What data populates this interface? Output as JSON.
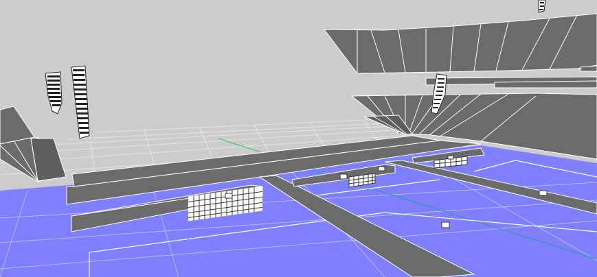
{
  "viewport": {
    "mode": "wireframe-3d-scene",
    "colors": {
      "background": "#cccccc",
      "floor": "#8080ff",
      "geometry": "#6b6b6b",
      "edge": "#ffffff",
      "grid_line": "#e8e8e8",
      "axis_green": "#2ecc40",
      "axis_teal": "#1aa58a"
    },
    "objects": [
      {
        "name": "left-speaker-array",
        "type": "line-array-speaker"
      },
      {
        "name": "center-speaker-array",
        "type": "line-array-speaker"
      },
      {
        "name": "right-speaker-array",
        "type": "line-array-speaker"
      },
      {
        "name": "top-speaker-array",
        "type": "line-array-speaker"
      },
      {
        "name": "upper-balcony",
        "type": "seating-tier"
      },
      {
        "name": "lower-balcony",
        "type": "seating-tier"
      },
      {
        "name": "left-tier",
        "type": "seating-tier"
      },
      {
        "name": "front-stage-bar",
        "type": "stage-riser"
      },
      {
        "name": "mid-stage-bar",
        "type": "stage-riser"
      },
      {
        "name": "rear-stage-bar",
        "type": "stage-riser"
      },
      {
        "name": "back-wall-bar",
        "type": "stage-riser"
      },
      {
        "name": "center-walkway",
        "type": "walkway"
      },
      {
        "name": "front-sub-array",
        "type": "subwoofer-array"
      },
      {
        "name": "mid-sub-array",
        "type": "subwoofer-array"
      },
      {
        "name": "rear-sub-array",
        "type": "subwoofer-array"
      },
      {
        "name": "floor-monitor-a",
        "type": "monitor-box"
      },
      {
        "name": "floor-monitor-b",
        "type": "monitor-box"
      }
    ]
  }
}
